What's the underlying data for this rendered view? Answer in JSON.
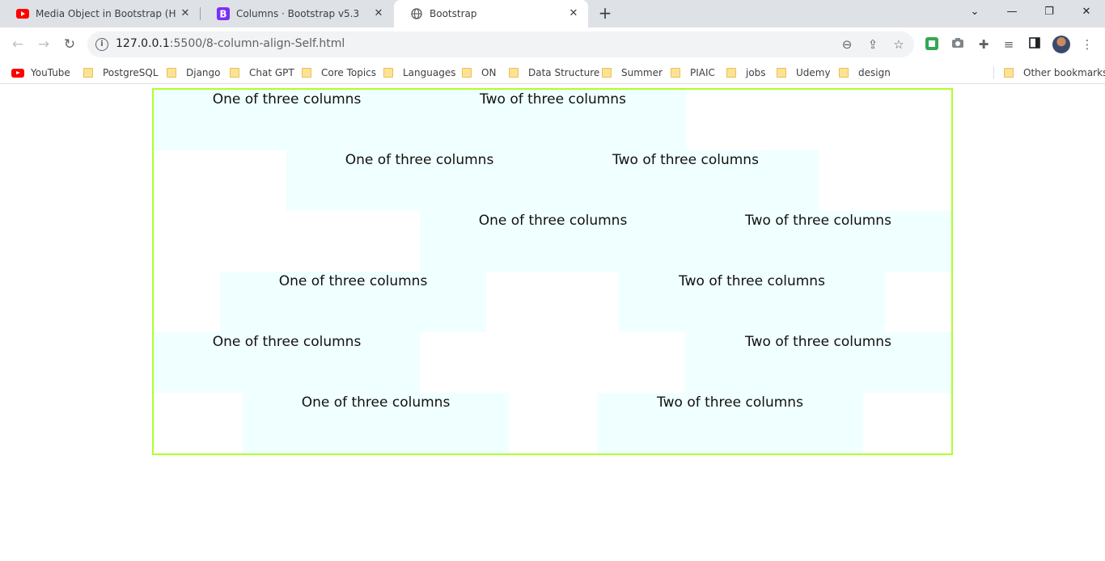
{
  "browser": {
    "tabs": [
      {
        "title": "Media Object in Bootstrap (Hindi)",
        "favicon": "youtube-icon"
      },
      {
        "title": "Columns · Bootstrap v5.3",
        "favicon": "bootstrap-icon"
      },
      {
        "title": "Bootstrap",
        "favicon": "globe-icon"
      }
    ],
    "url_host": "127.0.0.1",
    "url_path": ":5500/8-column-align-Self.html",
    "bookmarks": [
      "YouTube",
      "PostgreSQL",
      "Django",
      "Chat GPT",
      "Core Topics",
      "Languages",
      "ON",
      "Data Structure",
      "Summer",
      "PIAIC",
      "jobs",
      "Udemy",
      "design"
    ],
    "other_bookmarks": "Other bookmarks"
  },
  "page": {
    "col_one": "One of three columns",
    "col_two": "Two of three columns",
    "border_color": "#adff2f",
    "column_bg": "#f0ffff"
  }
}
